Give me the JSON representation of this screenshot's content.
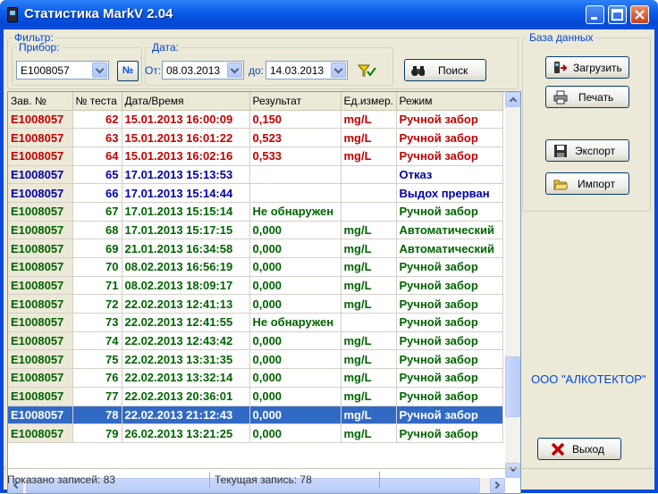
{
  "window": {
    "title": "Статистика MarkV 2.04"
  },
  "filter": {
    "legend": "Фильтр:",
    "device_label": "Прибор:",
    "device_value": "E1008057",
    "number_button": "№",
    "date_label": "Дата:",
    "from_label": "От:",
    "from_value": "08.03.2013",
    "to_label": "до:",
    "to_value": "14.03.2013",
    "search_label": "Поиск"
  },
  "database": {
    "legend": "База данных",
    "load_label": "Загрузить",
    "print_label": "Печать",
    "export_label": "Экспорт",
    "import_label": "Импорт",
    "company": "ООО \"АЛКОТЕКТОР\"",
    "exit_label": "Выход"
  },
  "table": {
    "headers": [
      "Зав. №",
      "№ теста",
      "Дата/Время",
      "Результат",
      "Ед.измер.",
      "Режим"
    ],
    "rows": [
      {
        "serial": "E1008057",
        "test": "62",
        "datetime": "15.01.2013 16:00:09",
        "result": "0,150",
        "unit": "mg/L",
        "mode": "Ручной забор",
        "color": "red"
      },
      {
        "serial": "E1008057",
        "test": "63",
        "datetime": "15.01.2013 16:01:22",
        "result": "0,523",
        "unit": "mg/L",
        "mode": "Ручной забор",
        "color": "red"
      },
      {
        "serial": "E1008057",
        "test": "64",
        "datetime": "15.01.2013 16:02:16",
        "result": "0,533",
        "unit": "mg/L",
        "mode": "Ручной забор",
        "color": "red"
      },
      {
        "serial": "E1008057",
        "test": "65",
        "datetime": "17.01.2013 15:13:53",
        "result": "",
        "unit": "",
        "mode": "Отказ",
        "color": "blue"
      },
      {
        "serial": "E1008057",
        "test": "66",
        "datetime": "17.01.2013 15:14:44",
        "result": "",
        "unit": "",
        "mode": "Выдох прерван",
        "color": "blue"
      },
      {
        "serial": "E1008057",
        "test": "67",
        "datetime": "17.01.2013 15:15:14",
        "result": "Не обнаружен",
        "unit": "",
        "mode": "Ручной забор",
        "color": "green"
      },
      {
        "serial": "E1008057",
        "test": "68",
        "datetime": "17.01.2013 15:17:15",
        "result": "0,000",
        "unit": "mg/L",
        "mode": "Автоматический",
        "color": "green"
      },
      {
        "serial": "E1008057",
        "test": "69",
        "datetime": "21.01.2013 16:34:58",
        "result": "0,000",
        "unit": "mg/L",
        "mode": "Автоматический",
        "color": "green"
      },
      {
        "serial": "E1008057",
        "test": "70",
        "datetime": "08.02.2013 16:56:19",
        "result": "0,000",
        "unit": "mg/L",
        "mode": "Ручной забор",
        "color": "green"
      },
      {
        "serial": "E1008057",
        "test": "71",
        "datetime": "08.02.2013 18:09:17",
        "result": "0,000",
        "unit": "mg/L",
        "mode": "Ручной забор",
        "color": "green"
      },
      {
        "serial": "E1008057",
        "test": "72",
        "datetime": "22.02.2013 12:41:13",
        "result": "0,000",
        "unit": "mg/L",
        "mode": "Ручной забор",
        "color": "green"
      },
      {
        "serial": "E1008057",
        "test": "73",
        "datetime": "22.02.2013 12:41:55",
        "result": "Не обнаружен",
        "unit": "",
        "mode": "Ручной забор",
        "color": "green"
      },
      {
        "serial": "E1008057",
        "test": "74",
        "datetime": "22.02.2013 12:43:42",
        "result": "0,000",
        "unit": "mg/L",
        "mode": "Ручной забор",
        "color": "green"
      },
      {
        "serial": "E1008057",
        "test": "75",
        "datetime": "22.02.2013 13:31:35",
        "result": "0,000",
        "unit": "mg/L",
        "mode": "Ручной забор",
        "color": "green"
      },
      {
        "serial": "E1008057",
        "test": "76",
        "datetime": "22.02.2013 13:32:14",
        "result": "0,000",
        "unit": "mg/L",
        "mode": "Ручной забор",
        "color": "green"
      },
      {
        "serial": "E1008057",
        "test": "77",
        "datetime": "22.02.2013 20:36:01",
        "result": "0,000",
        "unit": "mg/L",
        "mode": "Ручной забор",
        "color": "green"
      },
      {
        "serial": "E1008057",
        "test": "78",
        "datetime": "22.02.2013 21:12:43",
        "result": "0,000",
        "unit": "mg/L",
        "mode": "Ручной забор",
        "color": "sel"
      },
      {
        "serial": "E1008057",
        "test": "79",
        "datetime": "26.02.2013 13:21:25",
        "result": "0,000",
        "unit": "mg/L",
        "mode": "Ручной забор",
        "color": "green"
      }
    ]
  },
  "status": {
    "records_shown": "Показано записей: 83",
    "current_record": "Текущая запись: 78"
  }
}
